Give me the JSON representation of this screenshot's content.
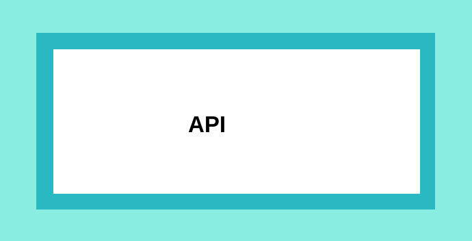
{
  "diagram": {
    "box_label": "API"
  },
  "colors": {
    "outer_background": "#89ede2",
    "frame_border": "#2ab9c2",
    "box_fill": "#ffffff",
    "label_text": "#000000"
  }
}
